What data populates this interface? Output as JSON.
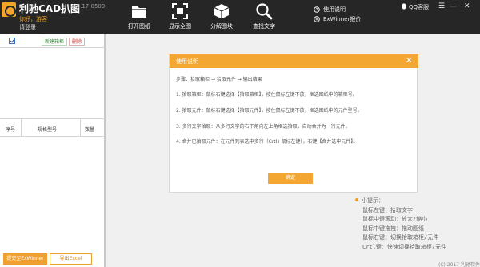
{
  "app": {
    "title": "利驰CAD扒图",
    "version": "4.0.17.0509",
    "greeting": "你好，游客",
    "login": "请登录",
    "accent": "#f3a632"
  },
  "toolbar": [
    {
      "label": "打开图纸",
      "icon": "folder-icon"
    },
    {
      "label": "显示全图",
      "icon": "fit-view-icon"
    },
    {
      "label": "分解图块",
      "icon": "cube-icon"
    },
    {
      "label": "查找文字",
      "icon": "search-icon"
    }
  ],
  "topright": {
    "qq": "QQ客服",
    "help": "使用说明",
    "quote": "ExWinner报价"
  },
  "left_panel": {
    "new_cabinet": "新建箱柜",
    "delete": "删除",
    "columns": [
      "序号",
      "规格型号",
      "数量"
    ],
    "send_button": "提交至ExWinner",
    "export_button": "导出Excel"
  },
  "dialog": {
    "title": "使用说明",
    "steps": "步骤：拾取箱柜 → 拾取元件 → 输出结果",
    "item1": "1. 拾取箱柜：鼠标右键选择【拾取箱柜】，按住鼠标左键不放，框选图纸中的箱柜号。",
    "item2": "2. 拾取元件：鼠标右键选择【拾取元件】，按住鼠标左键不放，框选图纸中的元件型号。",
    "item3": "3. 多行文字拾取：从多行文字的右下角向左上角框选拾取，自动合并为一行元件。",
    "item4": "4. 合并已拾取元件：在元件列表选中多行（Crtl+鼠标左键），右键【合并选中元件】。",
    "ok": "确定"
  },
  "tips": {
    "heading": "小提示：",
    "lines": [
      "鼠标左键：拾取文字",
      "鼠标中键滚动：放大/缩小",
      "鼠标中键拖拽：拖动图纸",
      "鼠标右键：切换拾取箱柜/元件",
      "Crtl键：快速切换拾取箱柜/元件"
    ]
  },
  "copyright": "(C) 2017 利驰软件"
}
